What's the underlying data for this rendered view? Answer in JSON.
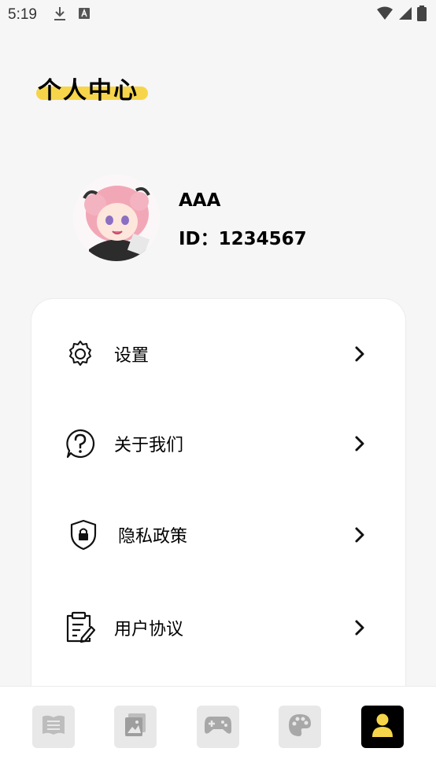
{
  "status_bar": {
    "time": "5:19"
  },
  "header": {
    "title": "个人中心"
  },
  "profile": {
    "username": "AAA",
    "user_id": "ID：1234567"
  },
  "menu": {
    "items": [
      {
        "label": "设置",
        "icon": "gear-icon"
      },
      {
        "label": "关于我们",
        "icon": "question-bubble-icon"
      },
      {
        "label": "隐私政策",
        "icon": "shield-lock-icon"
      },
      {
        "label": "用户协议",
        "icon": "clipboard-edit-icon"
      }
    ]
  },
  "bottom_nav": {
    "items": [
      {
        "icon": "book-icon"
      },
      {
        "icon": "photo-gallery-icon"
      },
      {
        "icon": "gamepad-icon"
      },
      {
        "icon": "palette-icon"
      },
      {
        "icon": "user-icon",
        "active": true
      }
    ]
  },
  "colors": {
    "accent": "#f7d54a",
    "active_nav": "#000000",
    "inactive_nav": "#e8e8e8"
  }
}
